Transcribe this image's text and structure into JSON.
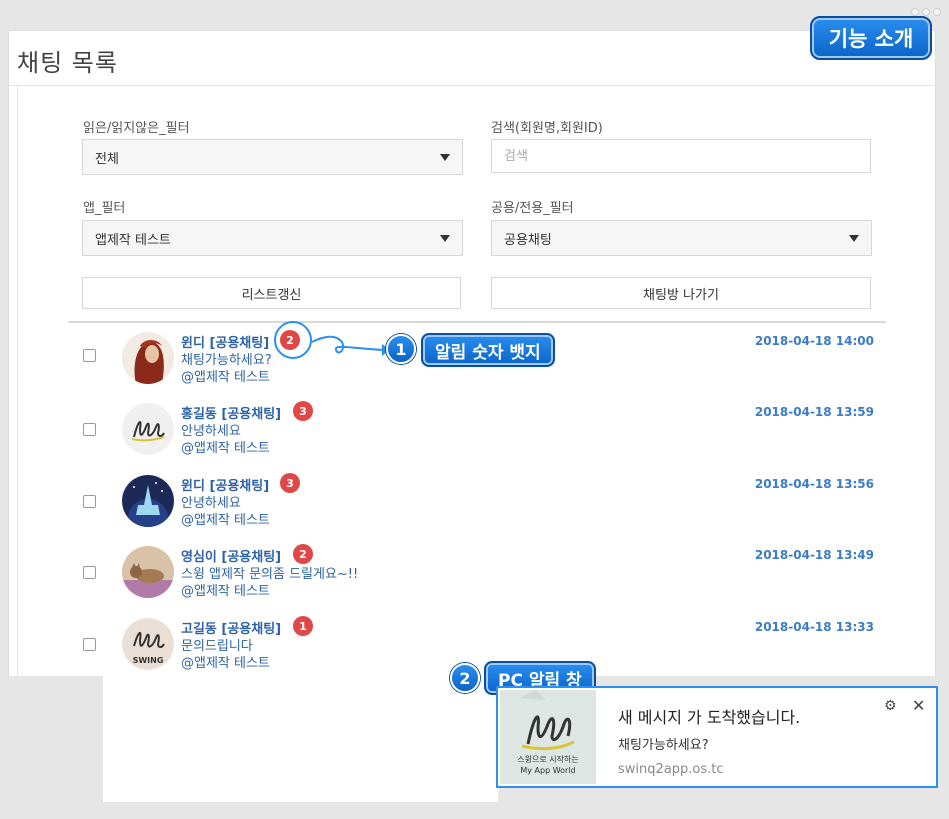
{
  "page": {
    "title": "채팅 목록",
    "feature_intro": "기능 소개"
  },
  "filters": {
    "read_filter": {
      "label": "읽은/읽지않은_필터",
      "value": "전체"
    },
    "search": {
      "label": "검색(회원명,회원ID)",
      "placeholder": "검색"
    },
    "app_filter": {
      "label": "앱_필터",
      "value": "앱제작 테스트"
    },
    "type_filter": {
      "label": "공용/전용_필터",
      "value": "공용채팅"
    },
    "refresh_button": "리스트갱신",
    "leave_button": "채팅방 나가기"
  },
  "chats": [
    {
      "name": "윈디 [공용채팅]",
      "badge": "2",
      "message": "채팅가능하세요?",
      "app": "@앱제작 테스트",
      "time": "2018-04-18 14:00",
      "avatar": "woman-photo"
    },
    {
      "name": "홍길동 [공용채팅]",
      "badge": "3",
      "message": "안녕하세요",
      "app": "@앱제작 테스트",
      "time": "2018-04-18 13:59",
      "avatar": "swing-logo"
    },
    {
      "name": "윈디 [공용채팅]",
      "badge": "3",
      "message": "안녕하세요",
      "app": "@앱제작 테스트",
      "time": "2018-04-18 13:56",
      "avatar": "night-castle"
    },
    {
      "name": "영심이 [공용채팅]",
      "badge": "2",
      "message": "스윙 앱제작 문의좀 드릴게요~!!",
      "app": "@앱제작 테스트",
      "time": "2018-04-18 13:49",
      "avatar": "cat-photo"
    },
    {
      "name": "고길동 [공용채팅]",
      "badge": "1",
      "message": "문의드립니다",
      "app": "@앱제작 테스트",
      "time": "2018-04-18 13:33",
      "avatar": "swing-logo-text"
    }
  ],
  "avatar_text": {
    "swing": "SWING"
  },
  "callouts": {
    "one": {
      "number": "1",
      "label": "알림 숫자 뱃지"
    },
    "two": {
      "number": "2",
      "label": "PC 알림 창"
    }
  },
  "notification": {
    "title": "새 메시지 가 도착했습니다.",
    "message": "채팅가능하세요?",
    "site": "swinq2app.os.tc",
    "image_caption_1": "스윙으로 시작하는",
    "image_caption_2": "My App World",
    "icons": [
      "gear-icon",
      "close-icon"
    ]
  },
  "colors": {
    "accent": "#2a8ff0",
    "badge_red": "#e04848",
    "name_blue": "#2d63a6",
    "time_blue": "#3a7cc5"
  }
}
